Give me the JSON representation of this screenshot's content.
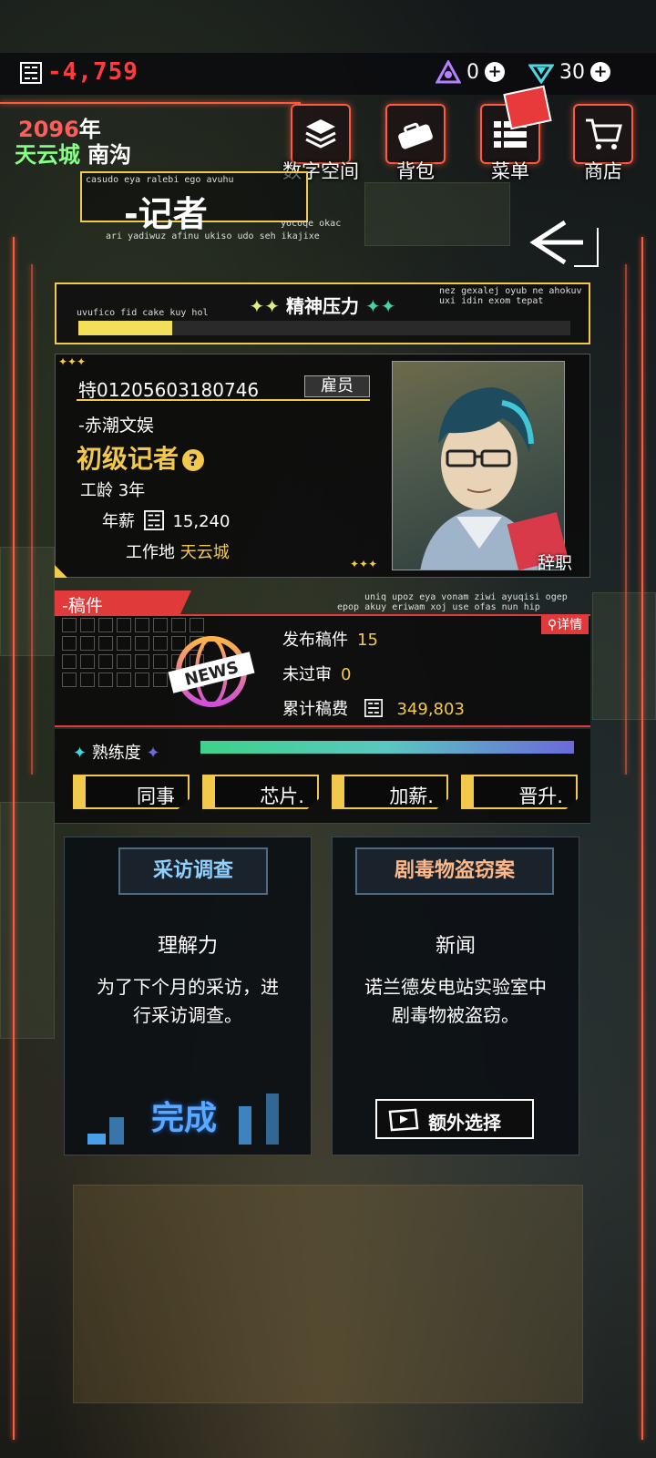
{
  "top": {
    "money": "-4,759",
    "resource_a": "0",
    "resource_b": "30"
  },
  "location": {
    "year_num": "2096",
    "year_unit": "年",
    "city": "天云城",
    "district": "南沟"
  },
  "nav": [
    {
      "label": "数字空间"
    },
    {
      "label": "背包"
    },
    {
      "label": "菜单"
    },
    {
      "label": "商店"
    }
  ],
  "title": {
    "main": "-记者",
    "flavor_top": "casudo eya ralebi ego avuhu",
    "flavor_right": "yocoqe okac",
    "flavor_bottom": "ari yadiwuz afinu ukiso udo seh ikajixe"
  },
  "stress": {
    "title": "精神压力",
    "flavor_left": "uvufico fid cake kuy hol",
    "flavor_right": "nez gexalej oyub ne ahokuv uxi idin exom tepat",
    "level": 0.19
  },
  "profile": {
    "id": "特01205603180746",
    "role": "雇员",
    "company": "-赤潮文娱",
    "job": "初级记者",
    "tenure_label": "工龄",
    "tenure_value": "3年",
    "salary_label": "年薪",
    "salary_value": "15,240",
    "workplace_label": "工作地",
    "workplace_value": "天云城",
    "resign": "辞职"
  },
  "manuscripts": {
    "tab": "-稿件",
    "flavor_1": "uniq upoz eya vonam ziwi ayuqisi ogep",
    "flavor_2": "epop akuy eriwam xoj use ofas nun hip",
    "detail": "详情",
    "news_badge": "NEWS",
    "published_label": "发布稿件",
    "published_value": "15",
    "rejected_label": "未过审",
    "rejected_value": "0",
    "fees_label": "累计稿费",
    "fees_value": "349,803"
  },
  "proficiency": {
    "label": "熟练度",
    "level": 1.0
  },
  "actions": [
    {
      "label": "同事"
    },
    {
      "label": "芯片."
    },
    {
      "label": "加薪."
    },
    {
      "label": "晋升."
    }
  ],
  "events": [
    {
      "header": "采访调查",
      "subtitle": "理解力",
      "desc": "为了下个月的采访，进行采访调查。",
      "status": "完成"
    },
    {
      "header": "剧毒物盗窃案",
      "subtitle": "新闻",
      "desc": "诺兰德发电站实验室中剧毒物被盗窃。",
      "button": "额外选择"
    }
  ],
  "colors": {
    "accent_yellow": "#f2c94c",
    "accent_red": "#e03a3a",
    "frame_orange": "#ff5a3c",
    "money_red": "#ff3b3b"
  }
}
